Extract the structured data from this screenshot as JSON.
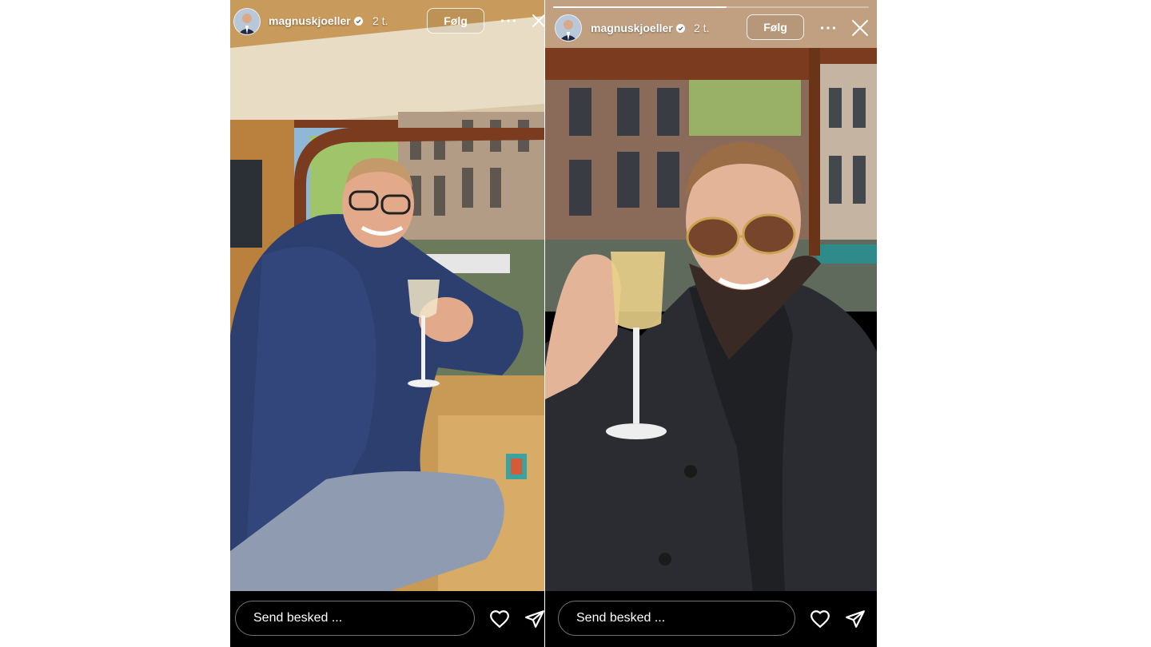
{
  "stories": [
    {
      "username": "magnuskjoeller",
      "time_ago": "2 t.",
      "follow_label": "Følg",
      "message_placeholder": "Send besked ..."
    },
    {
      "username": "magnuskjoeller",
      "time_ago": "2 t.",
      "follow_label": "Følg",
      "message_placeholder": "Send besked ...",
      "progress": 0.55
    }
  ],
  "icons": {
    "more": "more-horizontal-icon",
    "close": "close-icon",
    "like": "heart-icon",
    "share": "send-icon",
    "verified": "verified-badge-icon"
  },
  "colors": {
    "background": "#ffffff",
    "story_bg": "#000000",
    "text": "#ffffff",
    "verified": "#ffffff"
  }
}
